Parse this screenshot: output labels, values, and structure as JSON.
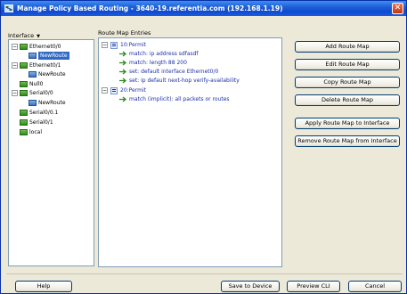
{
  "window": {
    "title": "Manage Policy Based Routing - 3640-19.referentia.com (192.168.1.19)",
    "close_glyph": "✕"
  },
  "interface_panel": {
    "header": "Interface",
    "tree": [
      {
        "label": "Ethernet0/0",
        "type": "interface",
        "expander": "−"
      },
      {
        "label": "NewRoute",
        "type": "routemap",
        "selected": true
      },
      {
        "label": "Ethernet0/1",
        "type": "interface",
        "expander": "−"
      },
      {
        "label": "NewRoute",
        "type": "routemap"
      },
      {
        "label": "Null0",
        "type": "interface"
      },
      {
        "label": "Serial0/0",
        "type": "interface",
        "expander": "−"
      },
      {
        "label": "NewRoute",
        "type": "routemap"
      },
      {
        "label": "Serial0/0.1",
        "type": "interface"
      },
      {
        "label": "Serial0/1",
        "type": "interface"
      },
      {
        "label": "local",
        "type": "interface"
      }
    ]
  },
  "route_map_panel": {
    "header": "Route Map Entries",
    "entries": [
      {
        "label": "10:Permit",
        "type": "permit",
        "expander": "−"
      },
      {
        "label": "match: ip address sdfasdf",
        "type": "entry"
      },
      {
        "label": "match: length 88 200",
        "type": "entry"
      },
      {
        "label": "set: default interface Ethernet0/0",
        "type": "entry"
      },
      {
        "label": "set: ip default next-hop verify-availability",
        "type": "entry"
      },
      {
        "label": "20:Permit",
        "type": "permit",
        "expander": "−"
      },
      {
        "label": "match (implicit): all packets or routes",
        "type": "entry"
      }
    ]
  },
  "actions": {
    "add": "Add Route Map",
    "edit": "Edit Route Map",
    "copy": "Copy Route Map",
    "delete": "Delete Route Map",
    "apply": "Apply Route Map to Interface",
    "remove": "Remove Route Map from Interface"
  },
  "footer": {
    "help": "Help",
    "save": "Save to Device",
    "preview": "Preview CLI",
    "cancel": "Cancel"
  }
}
